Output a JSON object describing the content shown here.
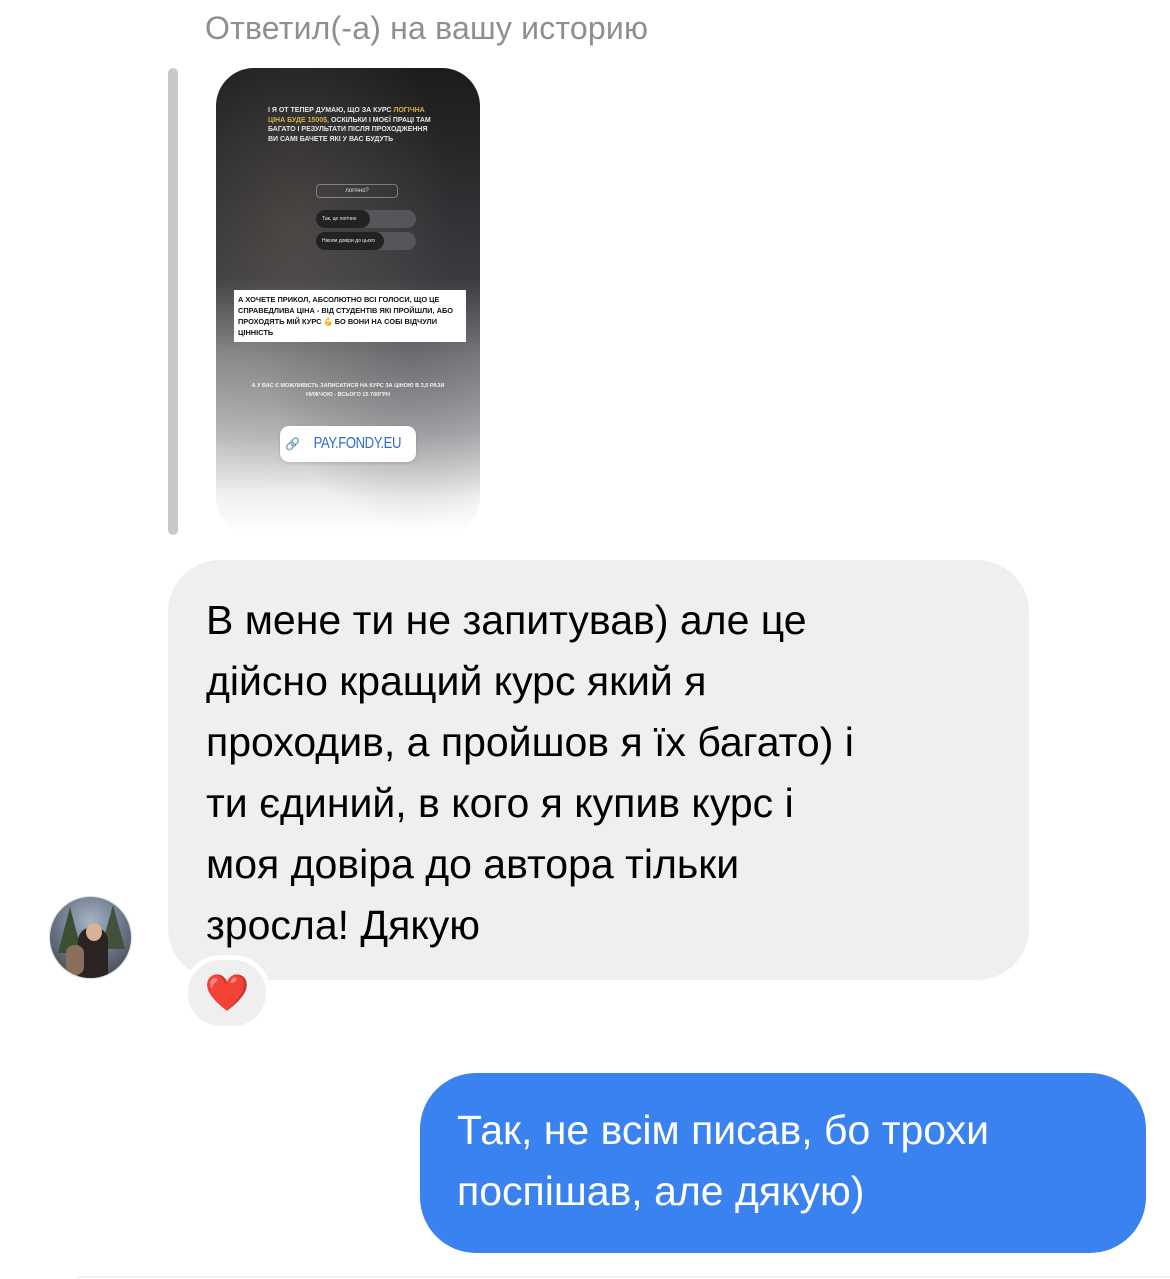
{
  "reply_context": {
    "label": "Ответил(-а) на вашу историю"
  },
  "story": {
    "top_text_part1": "і я от тепер думаю, що за курс",
    "top_text_highlight": "логічна ціна буде 1500$,",
    "top_text_part2": "оскільки і моєї праці там багато і результати після проходження ви самі бачете які у вас будуть",
    "poll_question": "логічно?",
    "poll_option_1": "Так, це логічно",
    "poll_option_1_fill": 0.54,
    "poll_option_2": "Ніколи довіри до цього",
    "poll_option_2_fill": 0.68,
    "middle_text": "А хочете прикол, абсолютно всі голоси, що це справедлива ціна - від студентів які пройшли, або проходять мій курс 💪 бо вони на собі відчули цінність",
    "small_text": "а у вас є можливість записатися на курс за ціною в 3,5 рази нижчою - всього 15 700грн",
    "link_label": "PAY.FONDY.EU",
    "link_icon": "link-chain-icon"
  },
  "incoming_message": {
    "text": "В мене ти не запитував) але це\nдійсно кращий курс який я\nпроходив, а пройшов я їх багато) і\nти єдиний, в кого я купив курс і\nмоя довіра до автора тільки\nзросла! Дякую",
    "reaction": "❤️",
    "bubble_color": "#efefef"
  },
  "outgoing_message": {
    "text": "Так, не всім писав, бо трохи\nпоспішав, але дякую)",
    "bubble_color": "#3b82f1"
  }
}
